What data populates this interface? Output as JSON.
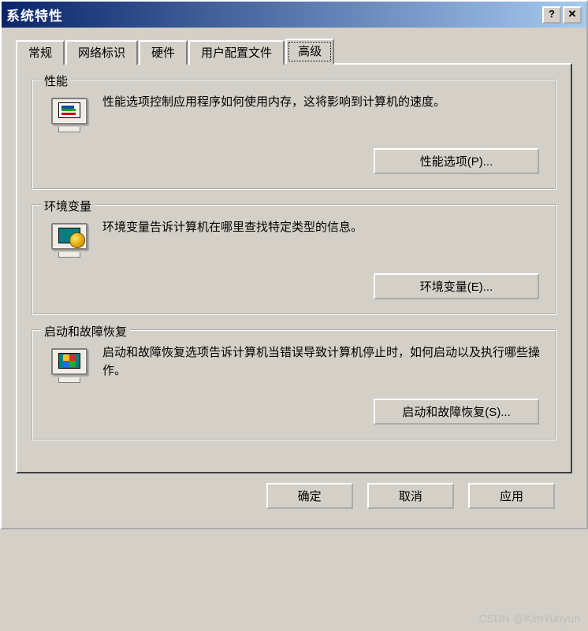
{
  "window": {
    "title": "系统特性"
  },
  "titlebar": {
    "help_symbol": "?",
    "close_symbol": "✕"
  },
  "tabs": [
    {
      "label": "常规"
    },
    {
      "label": "网络标识"
    },
    {
      "label": "硬件"
    },
    {
      "label": "用户配置文件"
    },
    {
      "label": "高级"
    }
  ],
  "groups": {
    "performance": {
      "title": "性能",
      "desc": "性能选项控制应用程序如何使用内存，这将影响到计算机的速度。",
      "button": "性能选项(P)...",
      "accel": "P"
    },
    "env": {
      "title": "环境变量",
      "desc": "环境变量告诉计算机在哪里查找特定类型的信息。",
      "button": "环境变量(E)...",
      "accel": "E"
    },
    "startup": {
      "title": "启动和故障恢复",
      "desc": "启动和故障恢复选项告诉计算机当错误导致计算机停止时，如何启动以及执行哪些操作。",
      "button": "启动和故障恢复(S)...",
      "accel": "S"
    }
  },
  "footer": {
    "ok": "确定",
    "cancel": "取消",
    "apply": "应用"
  },
  "watermark": "CSDN @KimYuhyun"
}
